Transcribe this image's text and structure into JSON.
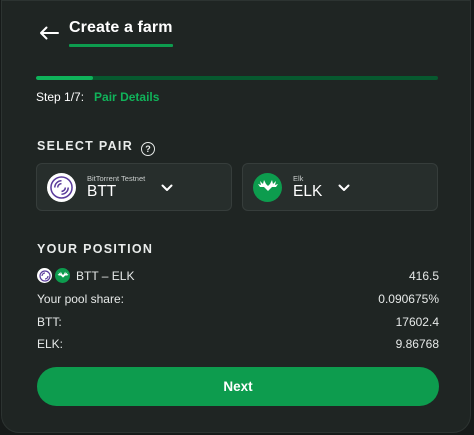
{
  "header": {
    "title": "Create a farm"
  },
  "progress": {
    "current_step": 1,
    "total_steps": 7,
    "fraction": 0.142857
  },
  "step": {
    "label": "Step 1/7:",
    "name": "Pair Details"
  },
  "select_pair": {
    "label": "SELECT PAIR",
    "help_glyph": "?",
    "token_a": {
      "network": "BitTorrent Testnet",
      "symbol": "BTT",
      "icon": "btt-logo"
    },
    "token_b": {
      "network": "Elk",
      "symbol": "ELK",
      "icon": "elk-logo"
    }
  },
  "position": {
    "label": "YOUR POSITION",
    "pair_label": "BTT – ELK",
    "pair_value": "416.5",
    "rows": [
      {
        "label": "Your pool share:",
        "value": "0.090675%"
      },
      {
        "label": "BTT:",
        "value": "17602.4"
      },
      {
        "label": "ELK:",
        "value": "9.86768"
      }
    ]
  },
  "next_button": {
    "label": "Next"
  },
  "colors": {
    "accent": "#0d9c4e",
    "panel": "#1f2523",
    "field": "#272e2c"
  }
}
